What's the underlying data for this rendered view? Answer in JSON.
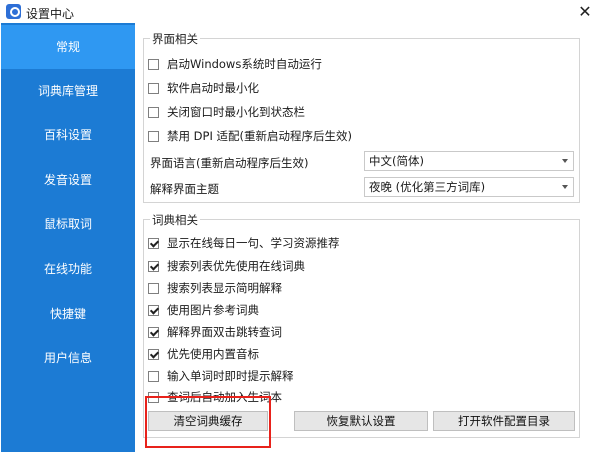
{
  "window": {
    "title": "设置中心",
    "close": "✕"
  },
  "sidebar": {
    "items": [
      {
        "label": "常规",
        "active": true
      },
      {
        "label": "词典库管理"
      },
      {
        "label": "百科设置"
      },
      {
        "label": "发音设置"
      },
      {
        "label": "鼠标取词"
      },
      {
        "label": "在线功能"
      },
      {
        "label": "快捷键"
      },
      {
        "label": "用户信息"
      }
    ]
  },
  "interface": {
    "title": "界面相关",
    "options": [
      {
        "label": "启动Windows系统时自动运行",
        "checked": false
      },
      {
        "label": "软件启动时最小化",
        "checked": false
      },
      {
        "label": "关闭窗口时最小化到状态栏",
        "checked": false
      },
      {
        "label": "禁用 DPI 适配(重新启动程序后生效)",
        "checked": false
      }
    ],
    "language_label": "界面语言(重新启动程序后生效)",
    "language_value": "中文(简体)",
    "theme_label": "解释界面主题",
    "theme_value": "夜晚 (优化第三方词库)"
  },
  "dictionary": {
    "title": "词典相关",
    "options": [
      {
        "label": "显示在线每日一句、学习资源推荐",
        "checked": true
      },
      {
        "label": "搜索列表优先使用在线词典",
        "checked": true
      },
      {
        "label": "搜索列表显示简明解释",
        "checked": false
      },
      {
        "label": "使用图片参考词典",
        "checked": true
      },
      {
        "label": "解释界面双击跳转查词",
        "checked": true
      },
      {
        "label": "优先使用内置音标",
        "checked": true
      },
      {
        "label": "输入单词时即时提示解释",
        "checked": false
      },
      {
        "label": "查词后自动加入生词本",
        "checked": false
      }
    ]
  },
  "buttons": {
    "clear_cache": "清空词典缓存",
    "restore_defaults": "恢复默认设置",
    "open_config_dir": "打开软件配置目录"
  },
  "colors": {
    "sidebar": "#1c7bd4",
    "sidebar_active": "#2f98f2",
    "highlight": "#e8221b"
  }
}
